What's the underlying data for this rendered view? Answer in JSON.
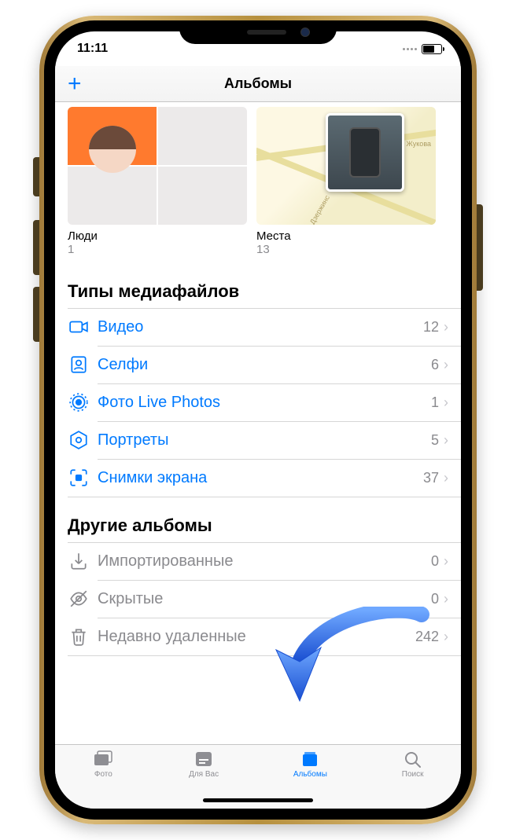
{
  "statusbar": {
    "time": "11:11"
  },
  "navbar": {
    "title": "Альбомы"
  },
  "tiles": {
    "people": {
      "label": "Люди",
      "count": "1"
    },
    "places": {
      "label": "Места",
      "count": "13",
      "street1": "т Жукова",
      "street2": "Дзержинс"
    }
  },
  "sections": {
    "media_types": {
      "header": "Типы медиафайлов",
      "items": [
        {
          "icon": "video",
          "label": "Видео",
          "count": "12"
        },
        {
          "icon": "selfie",
          "label": "Селфи",
          "count": "6"
        },
        {
          "icon": "live",
          "label": "Фото Live Photos",
          "count": "1"
        },
        {
          "icon": "portrait",
          "label": "Портреты",
          "count": "5"
        },
        {
          "icon": "screenshot",
          "label": "Снимки экрана",
          "count": "37"
        }
      ]
    },
    "other": {
      "header": "Другие альбомы",
      "items": [
        {
          "icon": "import",
          "label": "Импортированные",
          "count": "0"
        },
        {
          "icon": "hidden",
          "label": "Скрытые",
          "count": "0"
        },
        {
          "icon": "trash",
          "label": "Недавно удаленные",
          "count": "242"
        }
      ]
    }
  },
  "tabs": {
    "photos": "Фото",
    "foryou": "Для Вас",
    "albums": "Альбомы",
    "search": "Поиск"
  }
}
